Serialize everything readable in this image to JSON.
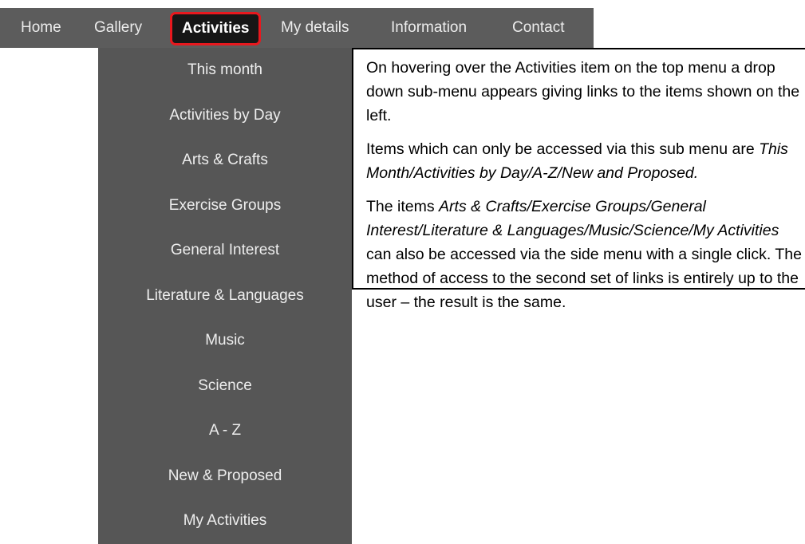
{
  "top_menu": {
    "items": [
      {
        "label": "Home"
      },
      {
        "label": "Gallery"
      },
      {
        "label": "Activities",
        "active": true
      },
      {
        "label": "My details"
      },
      {
        "label": "Information"
      },
      {
        "label": "Contact"
      }
    ]
  },
  "submenu": {
    "items": [
      {
        "label": "This month"
      },
      {
        "label": "Activities by Day"
      },
      {
        "label": "Arts & Crafts"
      },
      {
        "label": "Exercise Groups"
      },
      {
        "label": "General Interest"
      },
      {
        "label": "Literature & Languages"
      },
      {
        "label": "Music"
      },
      {
        "label": "Science"
      },
      {
        "label": "A - Z"
      },
      {
        "label": "New & Proposed"
      },
      {
        "label": "My Activities"
      }
    ]
  },
  "callout": {
    "p1": "On hovering over the Activities item on the top menu a drop down sub-menu appears giving links to the items shown on the left.",
    "p2_text": "Items which can only be accessed via this sub menu are ",
    "p2_italic": "This Month/Activities by Day/A-Z/New and Proposed.",
    "p3_text_a": "The items ",
    "p3_italic": "Arts & Crafts/Exercise Groups/General Interest/Literature & Languages/Music/Science/My Activities",
    "p3_text_b": " can also be accessed via the side menu with a single click.  The method of access to the second set of links is entirely up to the user – the result is the same."
  },
  "colors": {
    "menu_bg": "#5c5c5c",
    "submenu_bg": "#565656",
    "active_bg": "#161616",
    "active_border": "#e8181e",
    "menu_text": "#ececec"
  }
}
